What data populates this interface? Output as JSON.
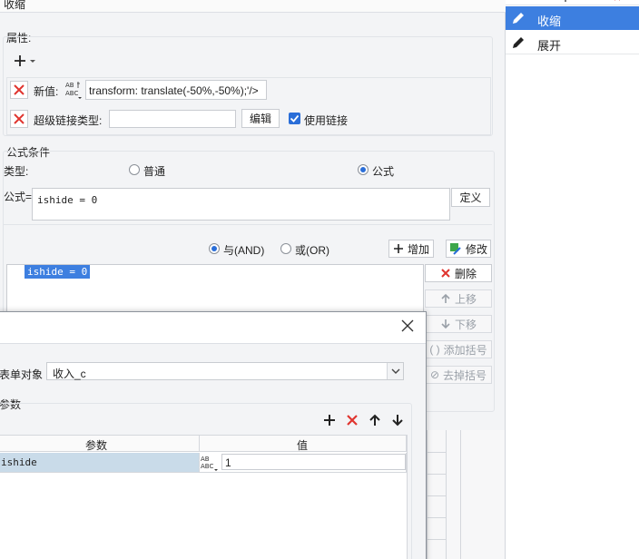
{
  "window": {
    "title": "收缩"
  },
  "attributes": {
    "title": "属性:",
    "add_icon": "plus-icon",
    "new_value_label": "新值:",
    "new_value_text": "transform: translate(-50%,-50%);'/>",
    "hyperlink_type_label": "超级链接类型:",
    "hyperlink_type_value": "",
    "edit_button": "编辑",
    "use_link_label": "使用链接",
    "use_link_checked": true
  },
  "formula_condition": {
    "title": "公式条件",
    "type_label": "类型:",
    "type_normal": "普通",
    "type_formula": "公式",
    "formula_label": "公式=",
    "formula_value": "ishide = 0",
    "define_button": "定义",
    "and_label": "与(AND)",
    "or_label": "或(OR)",
    "add_button": "增加",
    "modify_button": "修改",
    "conditions": [
      "ishide = 0"
    ],
    "delete_button": "删除",
    "move_up_button": "上移",
    "move_down_button": "下移",
    "add_bracket_button": "添加括号",
    "remove_bracket_button": "去掉括号"
  },
  "right_panel": {
    "items": [
      {
        "label": "收缩",
        "selected": true
      },
      {
        "label": "展开",
        "selected": false
      }
    ]
  },
  "dialog": {
    "form_object_label": "表单对象",
    "form_object_value": "收入_c",
    "params_title": "参数",
    "table": {
      "headers": [
        "参数",
        "值"
      ],
      "rows": [
        {
          "param": "ishide",
          "value": "1"
        }
      ]
    }
  },
  "colors": {
    "accent": "#2a6ed8",
    "selection": "#3d7fe0",
    "red": "#e0352f",
    "row_highlight": "#c9dbe9"
  }
}
